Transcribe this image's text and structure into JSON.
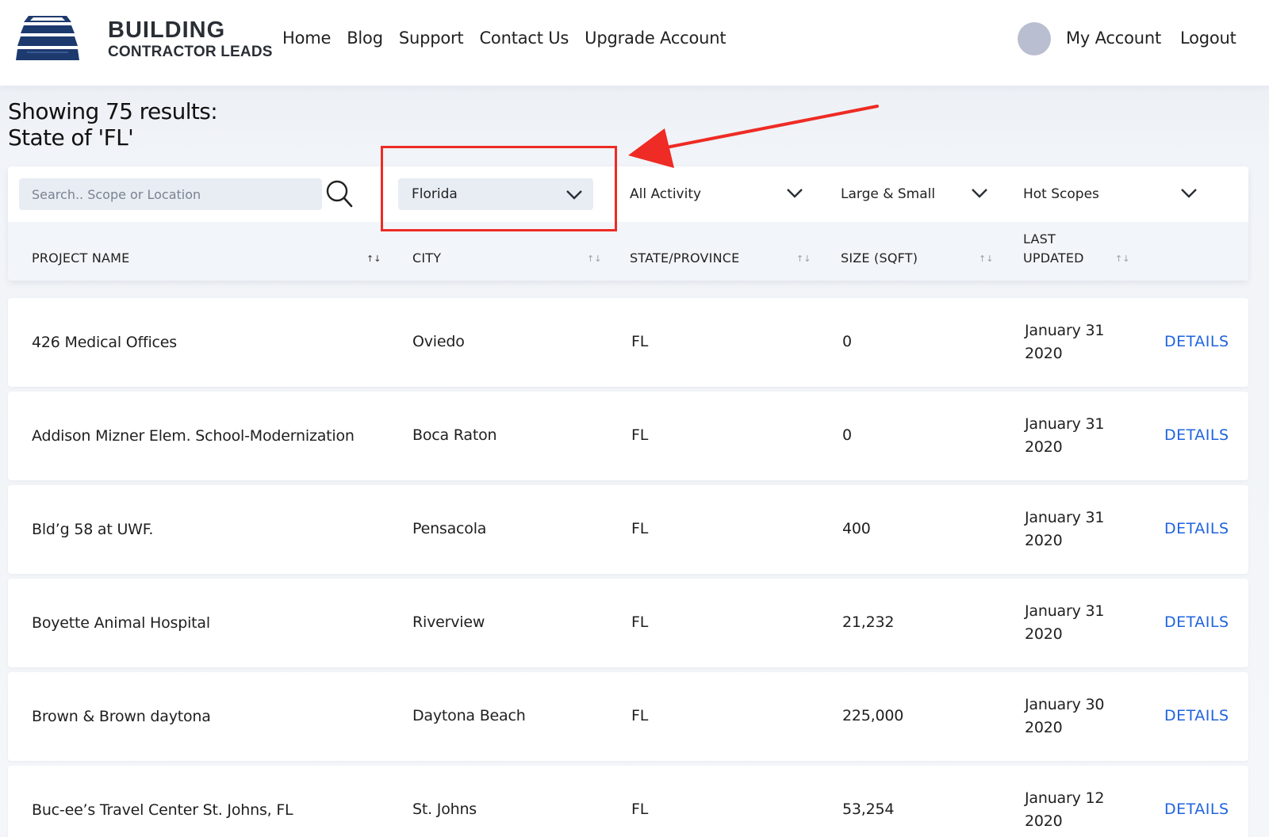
{
  "brand": {
    "line1": "BUILDING",
    "line2": "CONTRACTOR LEADS",
    "icon": "stacked-building-logo"
  },
  "nav": [
    "Home",
    "Blog",
    "Support",
    "Contact Us",
    "Upgrade Account"
  ],
  "account": {
    "my_account": "My Account",
    "logout": "Logout"
  },
  "results": {
    "line1": "Showing 75 results:",
    "line2": "State of 'FL'"
  },
  "filters": {
    "search_placeholder": "Search.. Scope or Location",
    "state": "Florida",
    "activity": "All Activity",
    "size": "Large & Small",
    "scopes": "Hot Scopes"
  },
  "columns": {
    "project": "PROJECT NAME",
    "city": "CITY",
    "state": "STATE/PROVINCE",
    "size": "SIZE (SQFT)",
    "updated_1": "LAST",
    "updated_2": "UPDATED"
  },
  "details_label": "DETAILS",
  "rows": [
    {
      "name": "426 Medical Offices",
      "city": "Oviedo",
      "state": "FL",
      "size": "0",
      "date_1": "January 31",
      "date_2": "2020"
    },
    {
      "name": "Addison Mizner Elem. School-Modernization",
      "city": "Boca Raton",
      "state": "FL",
      "size": "0",
      "date_1": "January 31",
      "date_2": "2020"
    },
    {
      "name": "Bld’g 58 at UWF.",
      "city": "Pensacola",
      "state": "FL",
      "size": "400",
      "date_1": "January 31",
      "date_2": "2020"
    },
    {
      "name": "Boyette Animal Hospital",
      "city": "Riverview",
      "state": "FL",
      "size": "21,232",
      "date_1": "January 31",
      "date_2": "2020"
    },
    {
      "name": "Brown & Brown daytona",
      "city": "Daytona Beach",
      "state": "FL",
      "size": "225,000",
      "date_1": "January 30",
      "date_2": "2020"
    },
    {
      "name": "Buc-ee’s Travel Center St. Johns, FL",
      "city": "St. Johns",
      "state": "FL",
      "size": "53,254",
      "date_1": "January 12",
      "date_2": "2020"
    }
  ],
  "colors": {
    "accent_link": "#1f63e0",
    "highlight_red": "#ee2b24",
    "logo_navy": "#1d3a6e"
  }
}
